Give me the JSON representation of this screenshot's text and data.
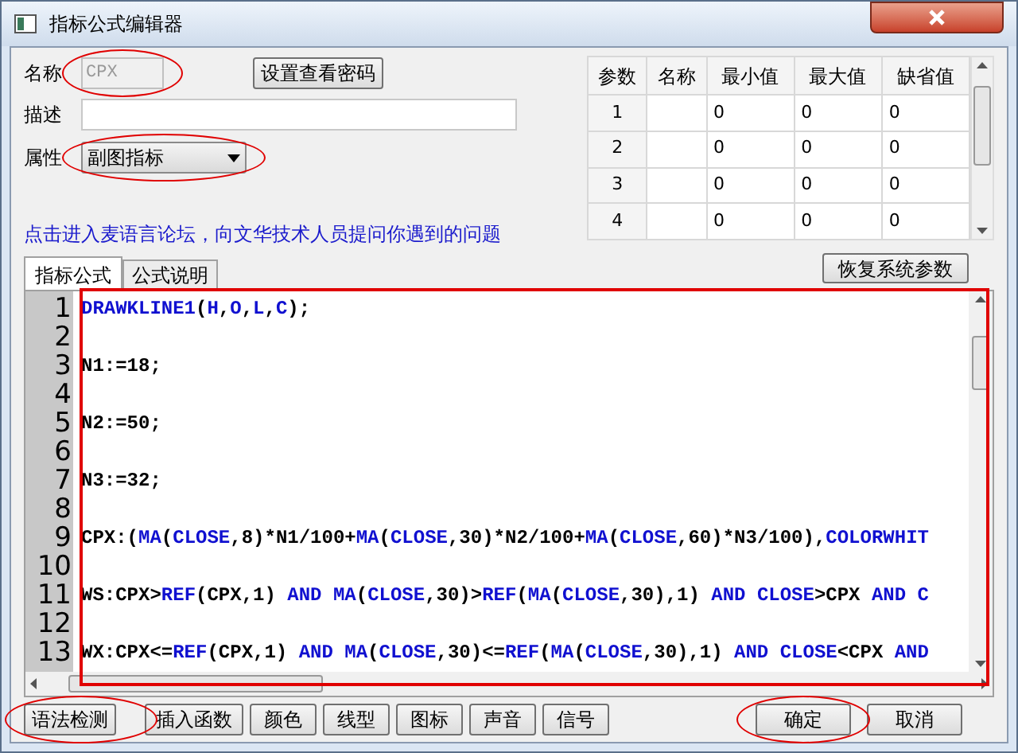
{
  "window": {
    "title": "指标公式编辑器"
  },
  "name_field": {
    "label": "名称",
    "value": "CPX",
    "disabled": true,
    "circled": true
  },
  "password_button": {
    "label": "设置查看密码"
  },
  "description_field": {
    "label": "描述"
  },
  "attribute": {
    "label": "属性",
    "value": "副图指标",
    "circled": true
  },
  "forum_link": "点击进入麦语言论坛，向文华技术人员提问你遇到的问题",
  "params_table": {
    "columns": [
      "参数",
      "名称",
      "最小值",
      "最大值",
      "缺省值"
    ],
    "rows": [
      [
        "1",
        "",
        "0",
        "0",
        "0"
      ],
      [
        "2",
        "",
        "0",
        "0",
        "0"
      ],
      [
        "3",
        "",
        "0",
        "0",
        "0"
      ],
      [
        "4",
        "",
        "0",
        "0",
        "0"
      ]
    ]
  },
  "restore_button": "恢复系统参数",
  "tabs": [
    {
      "label": "指标公式",
      "selected": true
    },
    {
      "label": "公式说明",
      "selected": false
    }
  ],
  "editor": {
    "boxed": true,
    "lines": [
      {
        "number": "1",
        "tokens": [
          {
            "text": "DRAWKLINE1",
            "kind": "keyword"
          },
          {
            "text": "(",
            "kind": "plain"
          },
          {
            "text": "H",
            "kind": "keyword"
          },
          {
            "text": ",",
            "kind": "plain"
          },
          {
            "text": "O",
            "kind": "keyword"
          },
          {
            "text": ",",
            "kind": "plain"
          },
          {
            "text": "L",
            "kind": "keyword"
          },
          {
            "text": ",",
            "kind": "plain"
          },
          {
            "text": "C",
            "kind": "keyword"
          },
          {
            "text": ");",
            "kind": "plain"
          }
        ]
      },
      {
        "number": "2"
      },
      {
        "number": "3",
        "tokens": [
          {
            "text": "N1:=18;",
            "kind": "plain"
          }
        ]
      },
      {
        "number": "4"
      },
      {
        "number": "5",
        "tokens": [
          {
            "text": "N2:=50;",
            "kind": "plain"
          }
        ]
      },
      {
        "number": "6"
      },
      {
        "number": "7",
        "tokens": [
          {
            "text": "N3:=32;",
            "kind": "plain"
          }
        ]
      },
      {
        "number": "8"
      },
      {
        "number": "9",
        "tokens": [
          {
            "text": "CPX:(",
            "kind": "plain"
          },
          {
            "text": "MA",
            "kind": "keyword"
          },
          {
            "text": "(",
            "kind": "plain"
          },
          {
            "text": "CLOSE",
            "kind": "keyword"
          },
          {
            "text": ",8)*N1/100+",
            "kind": "plain"
          },
          {
            "text": "MA",
            "kind": "keyword"
          },
          {
            "text": "(",
            "kind": "plain"
          },
          {
            "text": "CLOSE",
            "kind": "keyword"
          },
          {
            "text": ",30)*N2/100+",
            "kind": "plain"
          },
          {
            "text": "MA",
            "kind": "keyword"
          },
          {
            "text": "(",
            "kind": "plain"
          },
          {
            "text": "CLOSE",
            "kind": "keyword"
          },
          {
            "text": ",60)*N3/100),",
            "kind": "plain"
          },
          {
            "text": "COLORWHIT",
            "kind": "keyword"
          }
        ]
      },
      {
        "number": "10"
      },
      {
        "number": "11",
        "tokens": [
          {
            "text": "WS:CPX>",
            "kind": "plain"
          },
          {
            "text": "REF",
            "kind": "keyword"
          },
          {
            "text": "(CPX,1) ",
            "kind": "plain"
          },
          {
            "text": "AND MA",
            "kind": "keyword"
          },
          {
            "text": "(",
            "kind": "plain"
          },
          {
            "text": "CLOSE",
            "kind": "keyword"
          },
          {
            "text": ",30)>",
            "kind": "plain"
          },
          {
            "text": "REF",
            "kind": "keyword"
          },
          {
            "text": "(",
            "kind": "plain"
          },
          {
            "text": "MA",
            "kind": "keyword"
          },
          {
            "text": "(",
            "kind": "plain"
          },
          {
            "text": "CLOSE",
            "kind": "keyword"
          },
          {
            "text": ",30),1) ",
            "kind": "plain"
          },
          {
            "text": "AND CLOSE",
            "kind": "keyword"
          },
          {
            "text": ">CPX ",
            "kind": "plain"
          },
          {
            "text": "AND C",
            "kind": "keyword"
          }
        ]
      },
      {
        "number": "12"
      },
      {
        "number": "13",
        "tokens": [
          {
            "text": "WX:CPX<=",
            "kind": "plain"
          },
          {
            "text": "REF",
            "kind": "keyword"
          },
          {
            "text": "(CPX,1) ",
            "kind": "plain"
          },
          {
            "text": "AND MA",
            "kind": "keyword"
          },
          {
            "text": "(",
            "kind": "plain"
          },
          {
            "text": "CLOSE",
            "kind": "keyword"
          },
          {
            "text": ",30)<=",
            "kind": "plain"
          },
          {
            "text": "REF",
            "kind": "keyword"
          },
          {
            "text": "(",
            "kind": "plain"
          },
          {
            "text": "MA",
            "kind": "keyword"
          },
          {
            "text": "(",
            "kind": "plain"
          },
          {
            "text": "CLOSE",
            "kind": "keyword"
          },
          {
            "text": ",30),1) ",
            "kind": "plain"
          },
          {
            "text": "AND CLOSE",
            "kind": "keyword"
          },
          {
            "text": "<CPX ",
            "kind": "plain"
          },
          {
            "text": "AND",
            "kind": "keyword"
          }
        ]
      }
    ]
  },
  "tool_buttons": [
    {
      "label": "语法检测",
      "circled": true
    },
    {
      "label": "插入函数",
      "circled": false
    },
    {
      "label": "颜色",
      "circled": false
    },
    {
      "label": "线型",
      "circled": false
    },
    {
      "label": "图标",
      "circled": false
    },
    {
      "label": "声音",
      "circled": false
    },
    {
      "label": "信号",
      "circled": false
    }
  ],
  "dialog_buttons": [
    {
      "label": "确定",
      "circled": true
    },
    {
      "label": "取消",
      "circled": false
    }
  ]
}
